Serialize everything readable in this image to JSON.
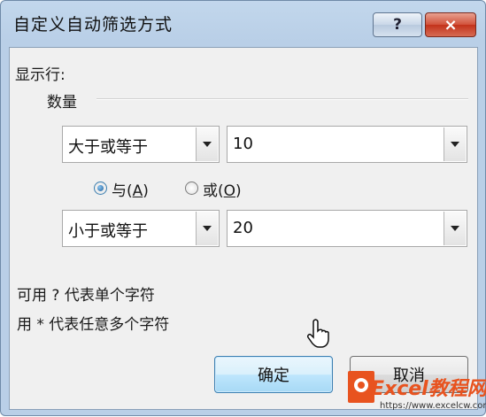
{
  "dialog": {
    "title": "自定义自动筛选方式",
    "help_glyph": "?",
    "close_glyph": "×"
  },
  "section_label": "显示行:",
  "field_name": "数量",
  "condition1": {
    "operator": "大于或等于",
    "value": "10"
  },
  "logic": {
    "and_label": "与",
    "and_paren_open": "(",
    "and_mnemonic": "A",
    "and_paren_close": ")",
    "or_label": "或",
    "or_paren_open": "(",
    "or_mnemonic": "O",
    "or_paren_close": ")",
    "selected": "and"
  },
  "condition2": {
    "operator": "小于或等于",
    "value": "20"
  },
  "hints": {
    "line1": "可用 ? 代表单个字符",
    "line2": "用 * 代表任意多个字符"
  },
  "buttons": {
    "ok": "确定",
    "cancel": "取消"
  },
  "watermark": {
    "brand": "Excel教程网",
    "url": "https://www.excelcw.com"
  },
  "colors": {
    "title_bar": "#b9cfe7",
    "close_button": "#c3321b",
    "default_button_border": "#3c7fb1",
    "dialog_body": "#f0f0f0",
    "watermark": "#e8531f"
  }
}
